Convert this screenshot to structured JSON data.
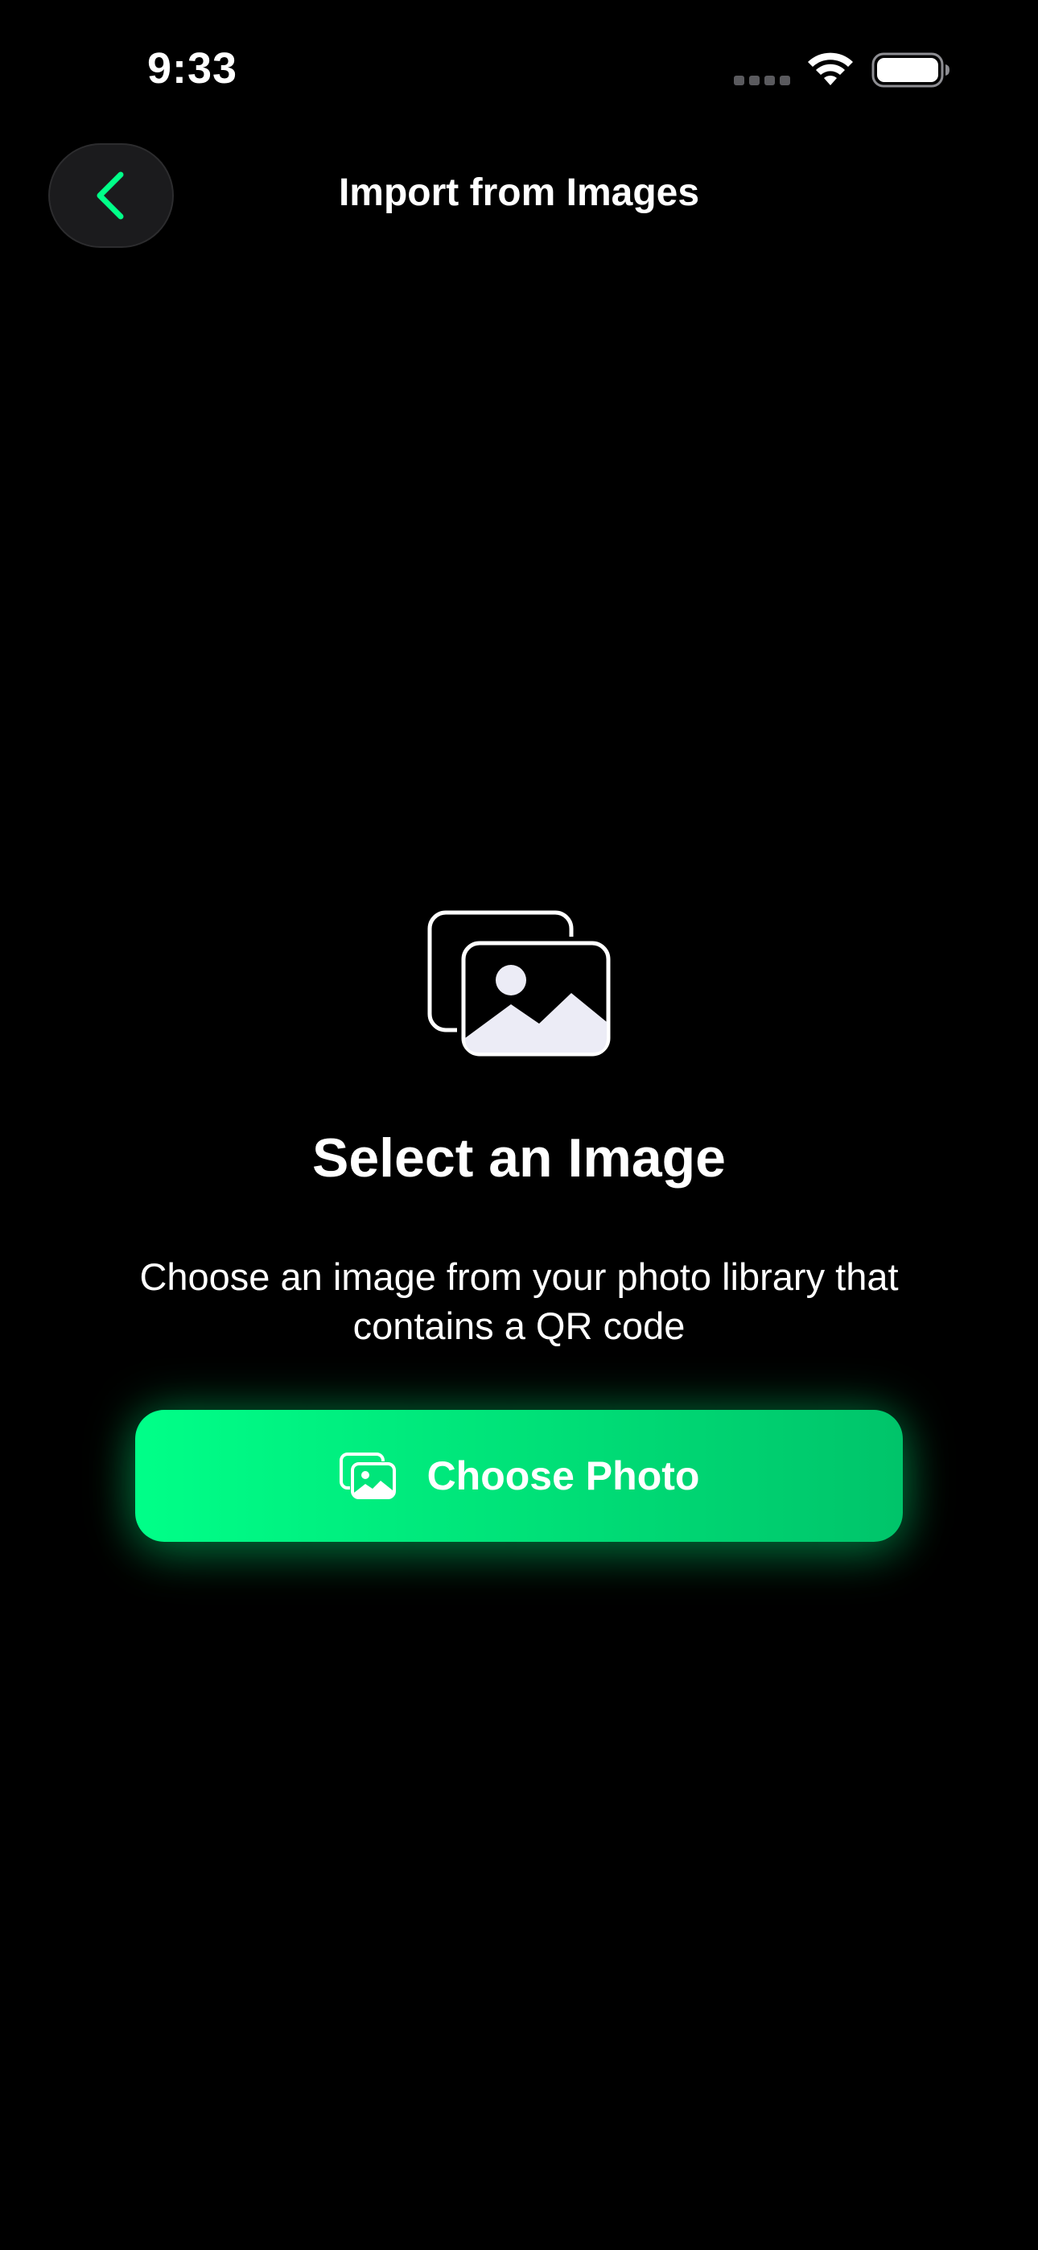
{
  "status_bar": {
    "time": "9:33",
    "icons": [
      "cellular-signal-icon",
      "wifi-icon",
      "battery-icon"
    ]
  },
  "nav": {
    "title": "Import from Images",
    "back_icon": "chevron-left-icon"
  },
  "empty_state": {
    "illustration_icon": "photo-stack-icon",
    "title": "Select an Image",
    "description": "Choose an image from your photo library that contains a QR code"
  },
  "primary_action": {
    "label": "Choose Photo",
    "icon": "photo-stack-icon"
  },
  "colors": {
    "background": "#000000",
    "accent": "#00FF88",
    "accent_dark": "#00C46A",
    "back_button_bg": "#1B1B1D",
    "text": "#FFFFFF",
    "illustration_fill": "#ECECF6"
  }
}
